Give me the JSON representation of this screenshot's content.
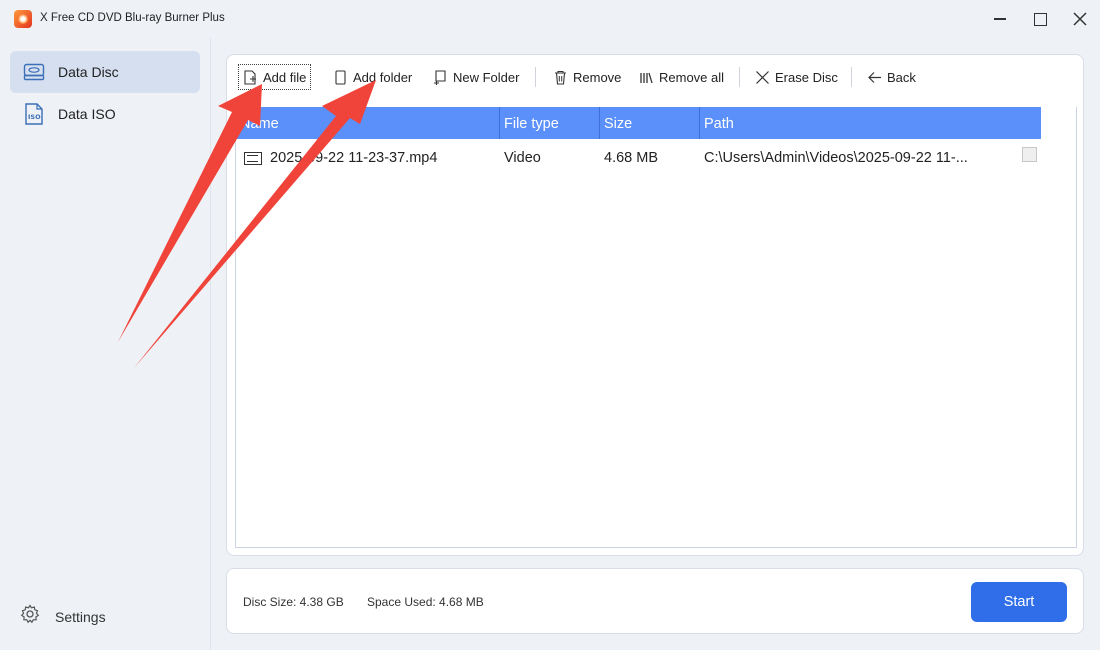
{
  "window": {
    "title": "X Free CD DVD Blu-ray Burner Plus",
    "logo_icon": "app-logo-icon",
    "controls": [
      "minimize-icon",
      "maximize-icon",
      "close-icon"
    ]
  },
  "sidebar": {
    "items": [
      {
        "label": "Data Disc",
        "icon": "disc-drive-icon",
        "active": true
      },
      {
        "label": "Data ISO",
        "icon": "iso-file-icon",
        "active": false
      }
    ],
    "settings": {
      "label": "Settings",
      "icon": "gear-icon"
    }
  },
  "toolbar": {
    "add_file": "Add file",
    "add_folder": "Add folder",
    "new_folder": "New Folder",
    "remove": "Remove",
    "remove_all": "Remove all",
    "erase_disc": "Erase Disc",
    "back": "Back"
  },
  "table": {
    "columns": [
      "Name",
      "File type",
      "Size",
      "Path"
    ],
    "rows": [
      {
        "name": "2025-09-22 11-23-37.mp4",
        "type": "Video",
        "size": "4.68 MB",
        "path": "C:\\Users\\Admin\\Videos\\2025-09-22 11-...",
        "checked": false
      }
    ]
  },
  "status": {
    "disc_size": "Disc Size: 4.38 GB",
    "space_used": "Space Used: 4.68 MB",
    "start": "Start"
  },
  "colors": {
    "accent": "#2f6ee8",
    "header": "#5b8ff9",
    "sidebar_active": "#d5dff0",
    "annotation_arrow": "#f0443a"
  }
}
